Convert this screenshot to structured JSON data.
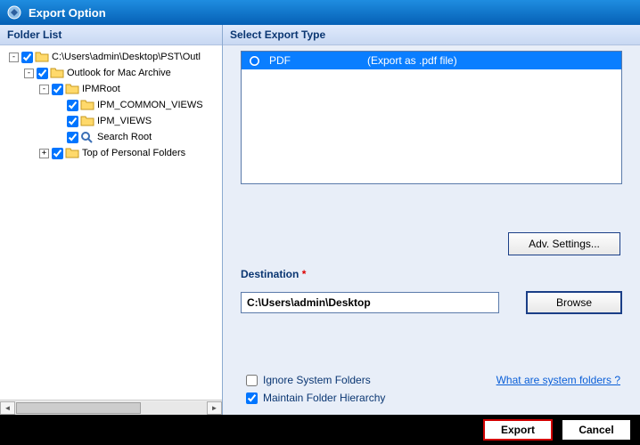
{
  "window": {
    "title": "Export Option"
  },
  "leftPanel": {
    "header": "Folder List"
  },
  "tree": {
    "nodes": [
      {
        "indent": 0,
        "toggle": "-",
        "checked": true,
        "icon": "folder",
        "label": "C:\\Users\\admin\\Desktop\\PST\\Outl"
      },
      {
        "indent": 1,
        "toggle": "-",
        "checked": true,
        "icon": "folder",
        "label": "Outlook for Mac Archive"
      },
      {
        "indent": 2,
        "toggle": "-",
        "checked": true,
        "icon": "folder",
        "label": "IPMRoot"
      },
      {
        "indent": 3,
        "toggle": "",
        "checked": true,
        "icon": "folder",
        "label": "IPM_COMMON_VIEWS"
      },
      {
        "indent": 3,
        "toggle": "",
        "checked": true,
        "icon": "folder",
        "label": "IPM_VIEWS"
      },
      {
        "indent": 3,
        "toggle": "",
        "checked": true,
        "icon": "search",
        "label": "Search Root"
      },
      {
        "indent": 2,
        "toggle": "+",
        "checked": true,
        "icon": "folder",
        "label": "Top of Personal Folders"
      }
    ]
  },
  "rightPanel": {
    "header": "Select Export Type",
    "exportTypes": [
      {
        "selected": true,
        "name": "PDF",
        "desc": "(Export as .pdf file)"
      }
    ],
    "advSettings": "Adv. Settings...",
    "destinationLabel": "Destination",
    "destinationValue": "C:\\Users\\admin\\Desktop",
    "browse": "Browse",
    "ignoreSystem": {
      "checked": false,
      "label": "Ignore System Folders"
    },
    "maintainHierarchy": {
      "checked": true,
      "label": "Maintain Folder Hierarchy"
    },
    "systemFoldersLink": "What are system folders ?"
  },
  "bottom": {
    "export": "Export",
    "cancel": "Cancel"
  }
}
